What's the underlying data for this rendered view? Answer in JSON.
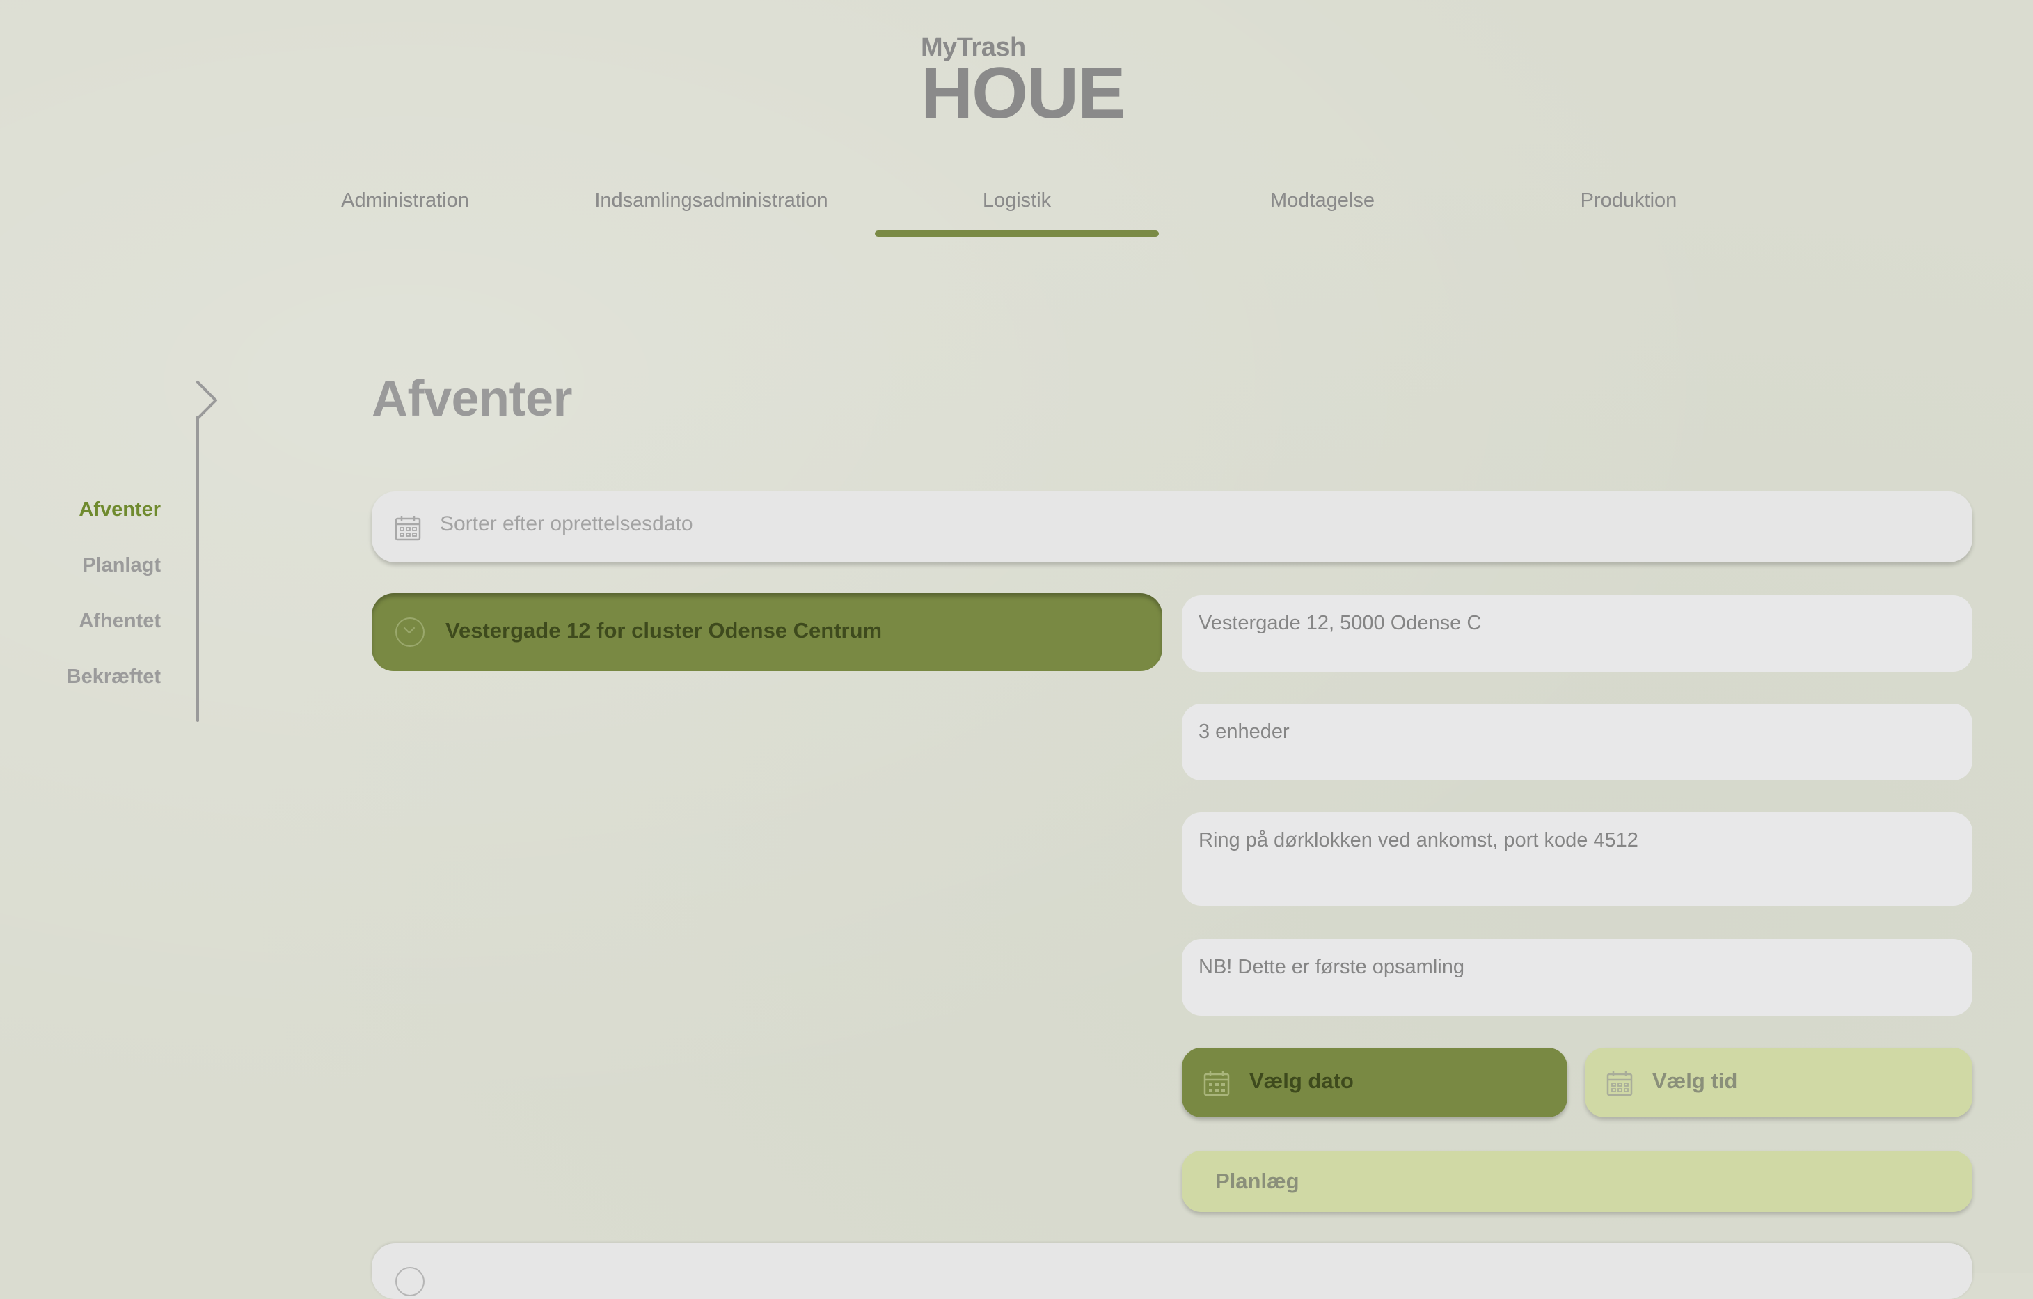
{
  "brand": {
    "small": "MyTrash",
    "big": "HOUE"
  },
  "topnav": {
    "tabs": [
      {
        "label": "Administration",
        "active": false
      },
      {
        "label": "Indsamlingsadministration",
        "active": false
      },
      {
        "label": "Logistik",
        "active": true
      },
      {
        "label": "Modtagelse",
        "active": false
      },
      {
        "label": "Produktion",
        "active": false
      }
    ]
  },
  "sidenav": {
    "items": [
      {
        "label": "Afventer",
        "active": true
      },
      {
        "label": "Planlagt",
        "active": false
      },
      {
        "label": "Afhentet",
        "active": false
      },
      {
        "label": "Bekræftet",
        "active": false
      }
    ]
  },
  "page": {
    "title": "Afventer"
  },
  "sort": {
    "placeholder": "Sorter efter oprettelsesdato",
    "icon": "calendar-icon"
  },
  "order": {
    "title": "Vestergade 12 for cluster Odense Centrum",
    "icon": "chevron-down-icon",
    "details": {
      "address": "Vestergade 12, 5000 Odense C",
      "units": "3 enheder",
      "instructions": "Ring på dørklokken ved ankomst, port kode 4512",
      "note": "NB! Dette er første opsamling"
    },
    "actions": {
      "date_label": "Vælg dato",
      "time_label": "Vælg tid",
      "plan_label": "Planlæg"
    }
  },
  "colors": {
    "accent": "#798943",
    "accent_light": "#d0d9a5",
    "background": "#dadcd0",
    "field": "#e8e8e9"
  }
}
